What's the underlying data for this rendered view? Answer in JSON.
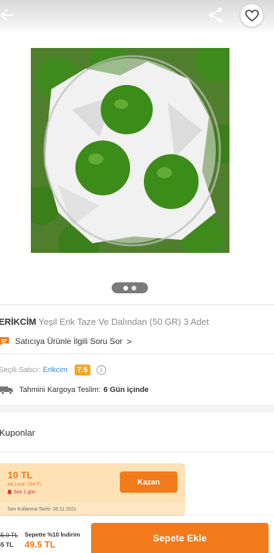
{
  "product": {
    "brand": "ERİKCİM",
    "name": "Yeşil Erik Taze Ve Dalından (50 GR) 3 Adet",
    "image_description_icon": "product-photo-green-plums",
    "gallery_dots_count": 2
  },
  "ask_seller": {
    "label": "Satıcıya Ürünle İlgili Soru Sor",
    "chevron": ">"
  },
  "seller": {
    "label": "Seçili Satıcı:",
    "name": "Erikcim",
    "rating": "7.5"
  },
  "shipping": {
    "label": "Tahmini Kargoya Teslim:",
    "days": "6 Gün içinde"
  },
  "coupons": {
    "title": "Kuponlar",
    "items": [
      {
        "amount": "10 TL",
        "limit": "Alt Limit: 150 TL",
        "last_day": "Son 1 gün",
        "button": "Kazan",
        "expiry": "Son Kullanma Tarihi: 26.11.2021"
      }
    ]
  },
  "cart": {
    "old_price": "55.0 TL",
    "old_price2": "55 TL",
    "discount_label": "Sepette %10 İndirim",
    "new_price": "49.5 TL",
    "button": "Sepete Ekle"
  },
  "colors": {
    "accent": "#f27a1a",
    "link": "#3a8ad8",
    "rating": "#f5a623"
  }
}
